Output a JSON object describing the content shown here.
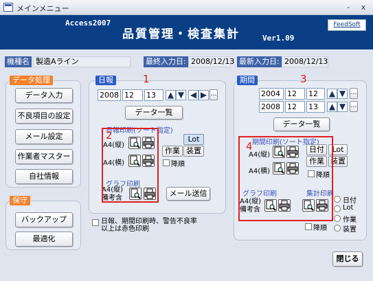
{
  "window": {
    "title": "メインメニュー",
    "minimize": "-",
    "close": "x"
  },
  "header": {
    "brand": "Access2007",
    "title": "品質管理・検査集計",
    "version": "Ver1.09",
    "feed_label": "FeedSoft"
  },
  "info": {
    "machine_label": "機種名",
    "machine_value": "製造Aライン",
    "last_input_label": "最終入力日:",
    "last_input_value": "2008/12/13",
    "latest_input_label": "最新入力日:",
    "latest_input_value": "2008/12/13"
  },
  "left": {
    "data_section": "データ処理",
    "buttons": [
      "データ入力",
      "不良項目の設定",
      "メール設定",
      "作業者マスター",
      "自社情報"
    ],
    "maint_section": "保守",
    "maint_buttons": [
      "バックアップ",
      "最適化"
    ]
  },
  "daily": {
    "label": "日報",
    "year": "2008",
    "month": "12",
    "day": "13",
    "list_btn": "データ一覧",
    "print_title": "日報印刷(ソート指定)",
    "a4_portrait": "A4(縦)",
    "a4_landscape": "A4(横)",
    "sort_lot": "Lot",
    "sort_work": "作業",
    "sort_device": "装置",
    "desc": "降順",
    "graph_title": "グラフ印刷",
    "graph_label": "A4(縦)\n備考含",
    "mail_btn": "メール送信",
    "note": "日報、期間印刷時、警告不良率\n以上は赤色印刷",
    "marker_num": "1",
    "marker_num2": "2"
  },
  "period": {
    "label": "期間",
    "from_year": "2004",
    "from_month": "12",
    "from_day": "12",
    "to_year": "2008",
    "to_month": "12",
    "to_day": "13",
    "list_btn": "データ一覧",
    "print_title": "期間印刷(ソート指定)",
    "a4_portrait": "A4(縦)",
    "a4_landscape": "A4(横)",
    "sort_date": "日付",
    "sort_lot": "Lot",
    "sort_work": "作業",
    "sort_device": "装置",
    "desc": "降順",
    "graph_title": "グラフ印刷",
    "graph_label": "A4(縦)\n備考含",
    "agg_title": "集計印刷",
    "agg_options": [
      "日付",
      "Lot",
      "作業",
      "装置"
    ],
    "agg_desc": "降順",
    "marker_num": "3",
    "marker_num2": "4"
  },
  "footer": {
    "close_btn": "閉じる"
  }
}
